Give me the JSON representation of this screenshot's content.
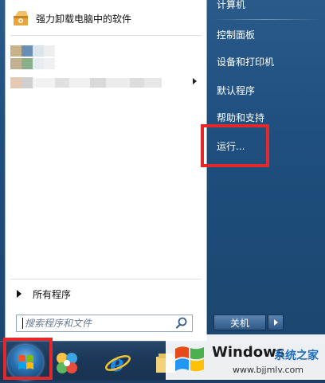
{
  "left_pane": {
    "pinned": [
      {
        "label": "强力卸载电脑中的软件",
        "icon": "uninstaller-box-icon"
      }
    ],
    "all_programs_label": "所有程序",
    "search_placeholder": "搜索程序和文件"
  },
  "right_pane": {
    "items": [
      {
        "label": "计算机"
      },
      {
        "label": "控制面板"
      },
      {
        "label": "设备和打印机"
      },
      {
        "label": "默认程序"
      },
      {
        "label": "帮助和支持"
      },
      {
        "label": "运行..."
      }
    ],
    "shutdown_label": "关机"
  },
  "taskbar": {
    "items": [
      {
        "icon": "start-orb-icon"
      },
      {
        "icon": "360-browser-icon"
      },
      {
        "icon": "internet-explorer-icon"
      },
      {
        "icon": "file-explorer-icon"
      }
    ]
  },
  "watermark": {
    "title": "Windows",
    "subtitle": "系统之家",
    "url": "www.bjjmlv.com"
  },
  "colors": {
    "highlight": "#e3282c",
    "menu_blue": "#1f4f7e",
    "taskbar": "#1b3656"
  }
}
